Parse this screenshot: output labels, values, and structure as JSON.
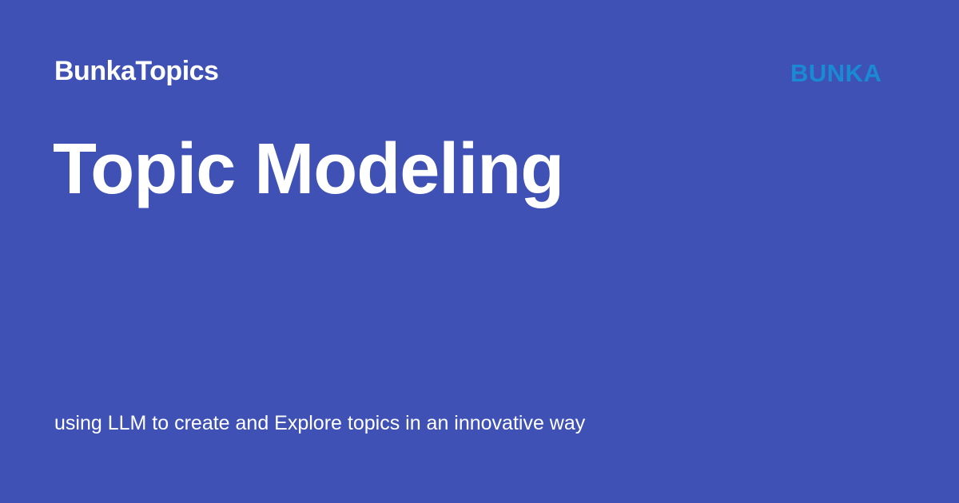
{
  "header": {
    "site_name": "BunkaTopics",
    "logo_text": "BUNKA"
  },
  "main": {
    "title": "Topic Modeling",
    "subtitle": "using LLM to create and Explore topics in an innovative way"
  },
  "colors": {
    "background": "#3f51b5",
    "text": "#ffffff",
    "logo": "#1a8ad4"
  }
}
